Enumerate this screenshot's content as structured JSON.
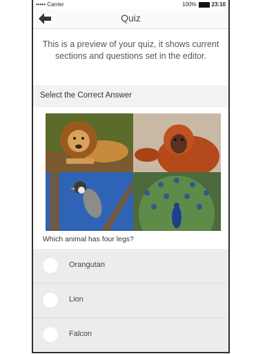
{
  "status": {
    "carrier": "••••• Carrier",
    "battery": "100%",
    "time": "23:10"
  },
  "nav": {
    "title": "Quiz"
  },
  "intro": "This is a preview of your quiz, it shows current sections and questions set in the editor.",
  "section": {
    "title": "Select the Correct Answer"
  },
  "images": [
    "lion",
    "orangutan",
    "falcon",
    "peacock"
  ],
  "question": "Which animal has four legs?",
  "options": [
    {
      "label": "Orangutan"
    },
    {
      "label": "Lion"
    },
    {
      "label": "Falcon"
    }
  ]
}
